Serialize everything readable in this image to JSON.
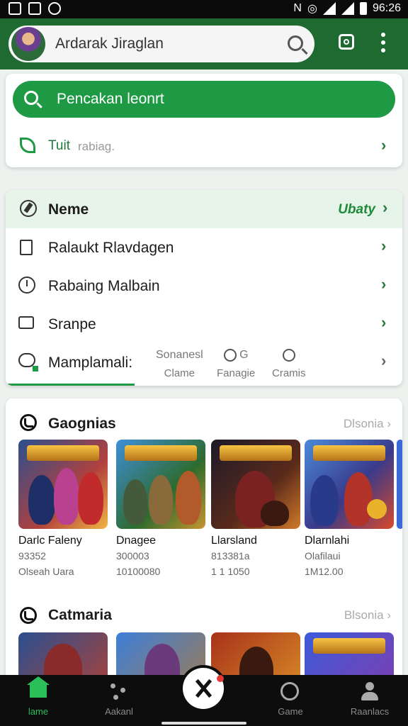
{
  "status_bar": {
    "time": "96:26"
  },
  "header": {
    "search_text": "Ardarak Jiraglan"
  },
  "search_card": {
    "button_label": "Pencakan leonrt",
    "row_label": "Tuit",
    "row_sub": "rabiag."
  },
  "menu": {
    "head_title": "Neme",
    "head_action": "Ubaty",
    "items": [
      {
        "label": "Ralaukt Rlavdagen"
      },
      {
        "label": "Rabaing Malbain"
      },
      {
        "label": "Sranpe"
      },
      {
        "label": "Mamplamali:"
      }
    ],
    "sub_tabs": [
      {
        "top": "Sonanesl",
        "bottom": "Clame"
      },
      {
        "top": "G",
        "bottom": "Fanagie"
      },
      {
        "top": "",
        "bottom": "Cramis"
      }
    ]
  },
  "section1": {
    "title": "Gaognias",
    "more": "Dlsonia",
    "games": [
      {
        "name": "Darlc Faleny",
        "line2": "93352",
        "line3": "Olseah Uara"
      },
      {
        "name": "Dnagee",
        "line2": "300003",
        "line3": "10100080"
      },
      {
        "name": "Llarsland",
        "line2": "813381a",
        "line3": "1 1 1050"
      },
      {
        "name": "Dlarnlahi",
        "line2": "Olafilaui",
        "line3": "1M12.00"
      }
    ]
  },
  "section2": {
    "title": "Catmaria",
    "more": "Blsonia"
  },
  "bottom_nav": {
    "items": [
      {
        "label": "lame"
      },
      {
        "label": "Aakanl"
      },
      {
        "label": "Game"
      },
      {
        "label": "Raanlacs"
      }
    ]
  },
  "colors": {
    "brand_green": "#1e9a45",
    "header_green": "#1f6a31",
    "nav_bg": "#0d0d0d"
  }
}
